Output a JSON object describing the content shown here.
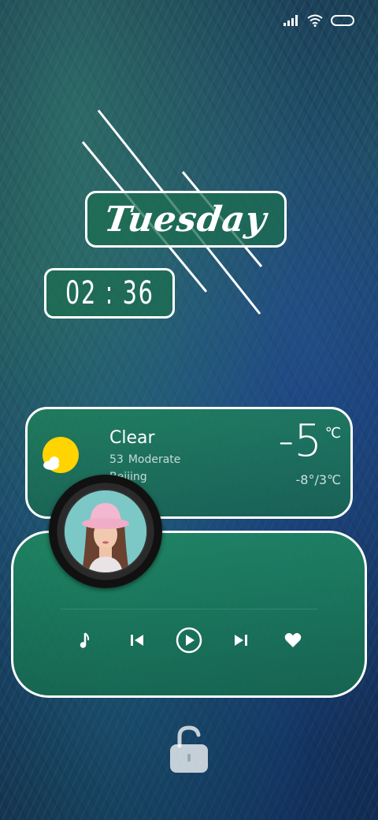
{
  "status_bar": {
    "icons": [
      "signal-icon",
      "wifi-icon",
      "battery-icon"
    ]
  },
  "clock": {
    "day": "Tuesday",
    "time": "02 : 36"
  },
  "weather": {
    "condition": "Clear",
    "aqi_value": "53",
    "aqi_label": "Moderate",
    "city": "Beijing",
    "temperature": "-5",
    "unit": "℃",
    "range": "-8°/3℃",
    "icon": "sun-cloud-icon"
  },
  "music": {
    "album_art": "album-art-woman-pink-hat",
    "controls": [
      "music-note-icon",
      "previous-icon",
      "play-icon",
      "next-icon",
      "heart-icon"
    ]
  },
  "lock": {
    "icon": "unlock-icon"
  },
  "colors": {
    "card_green": "#1e8a5c",
    "sun_yellow": "#ffd400",
    "border": "#ffffff"
  }
}
